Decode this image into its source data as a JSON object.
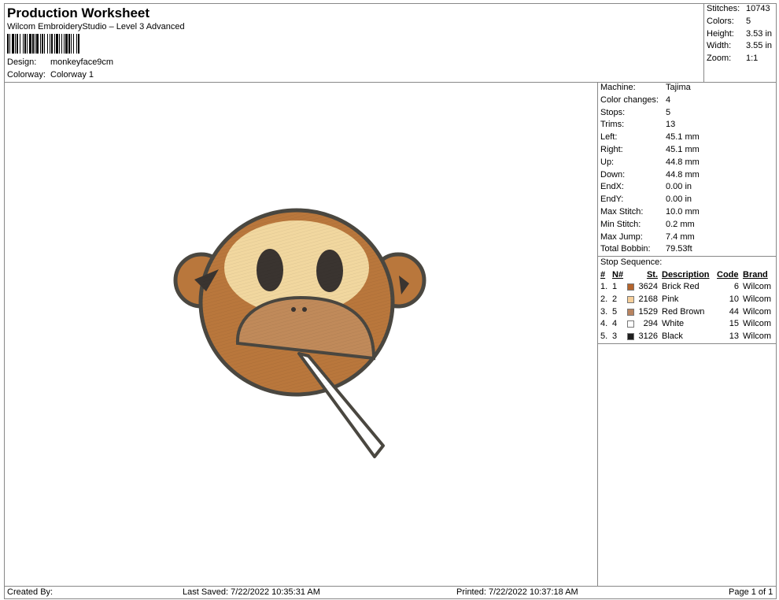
{
  "header": {
    "title": "Production Worksheet",
    "software": "Wilcom EmbroideryStudio – Level 3 Advanced",
    "design_label": "Design:",
    "design_value": "monkeyface9cm",
    "colorway_label": "Colorway:",
    "colorway_value": "Colorway 1"
  },
  "summary": [
    {
      "label": "Stitches:",
      "value": "10743"
    },
    {
      "label": "Colors:",
      "value": "5"
    },
    {
      "label": "Height:",
      "value": "3.53 in"
    },
    {
      "label": "Width:",
      "value": "3.55 in"
    },
    {
      "label": "Zoom:",
      "value": "1:1"
    }
  ],
  "machine_info": [
    {
      "label": "Machine:",
      "value": "Tajima"
    },
    {
      "label": "Color changes:",
      "value": "4"
    },
    {
      "label": "Stops:",
      "value": "5"
    },
    {
      "label": "Trims:",
      "value": "13"
    },
    {
      "label": "Left:",
      "value": "45.1 mm"
    },
    {
      "label": "Right:",
      "value": "45.1 mm"
    },
    {
      "label": "Up:",
      "value": "44.8 mm"
    },
    {
      "label": "Down:",
      "value": "44.8 mm"
    },
    {
      "label": "EndX:",
      "value": "0.00 in"
    },
    {
      "label": "EndY:",
      "value": "0.00 in"
    },
    {
      "label": "Max Stitch:",
      "value": "10.0 mm"
    },
    {
      "label": "Min Stitch:",
      "value": "0.2 mm"
    },
    {
      "label": "Max Jump:",
      "value": "7.4 mm"
    },
    {
      "label": "Total Bobbin:",
      "value": "79.53ft"
    }
  ],
  "stop_sequence": {
    "title": "Stop Sequence:",
    "headers": [
      "#",
      "N#",
      "St.",
      "Description",
      "Code",
      "Brand"
    ],
    "rows": [
      {
        "num": "1.",
        "n": "1",
        "color": "#b4642c",
        "st": "3624",
        "desc": "Brick Red",
        "code": "6",
        "brand": "Wilcom"
      },
      {
        "num": "2.",
        "n": "2",
        "color": "#f6cf9a",
        "st": "2168",
        "desc": "Pink",
        "code": "10",
        "brand": "Wilcom"
      },
      {
        "num": "3.",
        "n": "5",
        "color": "#b98460",
        "st": "1529",
        "desc": "Red Brown",
        "code": "44",
        "brand": "Wilcom"
      },
      {
        "num": "4.",
        "n": "4",
        "color": "#ffffff",
        "st": "294",
        "desc": "White",
        "code": "15",
        "brand": "Wilcom"
      },
      {
        "num": "5.",
        "n": "3",
        "color": "#1e1e1e",
        "st": "3126",
        "desc": "Black",
        "code": "13",
        "brand": "Wilcom"
      }
    ]
  },
  "footer": {
    "created_by": "Created By:",
    "last_saved": "Last Saved: 7/22/2022 10:35:31 AM",
    "printed": "Printed: 7/22/2022 10:37:18 AM",
    "page": "Page 1 of 1"
  },
  "colors": {
    "brick_red": "#b4642c",
    "pink": "#f3d59c",
    "red_brown": "#c08a5a",
    "outline": "#4a4740",
    "black": "#2a2520"
  }
}
